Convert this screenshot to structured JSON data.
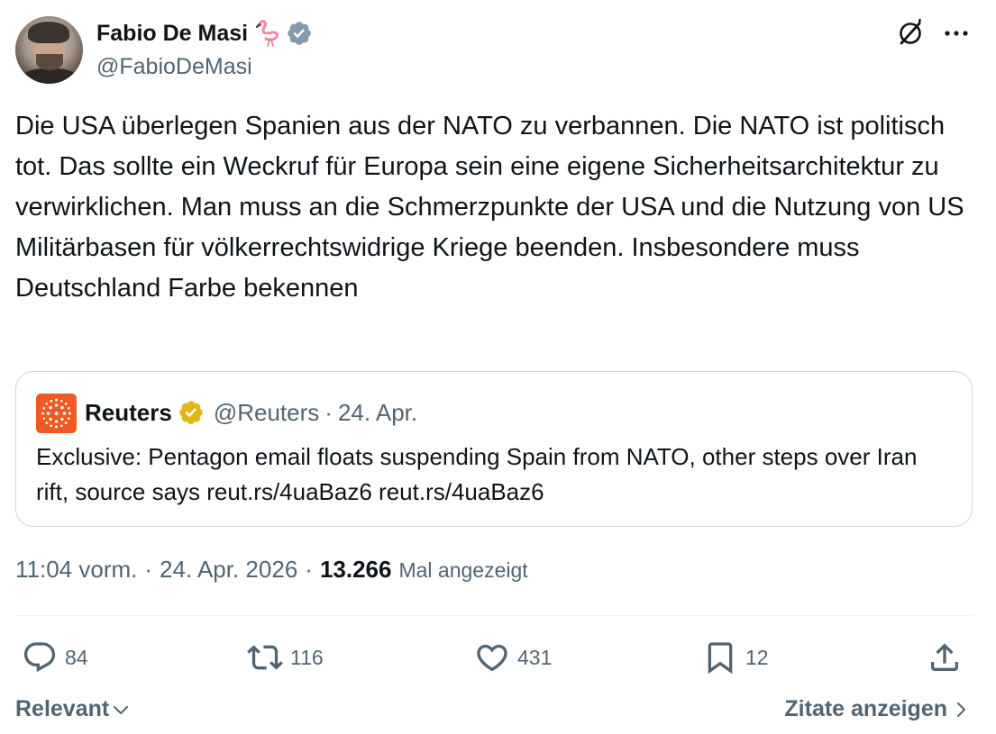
{
  "author": {
    "display_name": "Fabio De Masi",
    "handle": "@FabioDeMasi",
    "name_emoji": "flamingo-icon",
    "verified_badge_color": "#829aab"
  },
  "tweet": {
    "text": "Die USA überlegen Spanien aus der NATO zu verbannen. Die NATO ist politisch tot. Das sollte ein Weckruf für Europa sein eine eigene Sicherheitsarchitektur zu verwirklichen. Man muss an die Schmerzpunkte der USA und die Nutzung von US Militärbasen für völkerrechtswidrige Kriege beenden. Insbesondere muss Deutschland Farbe bekennen",
    "time": "11:04 vorm.",
    "date": "24. Apr. 2026",
    "views_count": "13.266",
    "views_label": "Mal angezeigt"
  },
  "quoted": {
    "name": "Reuters",
    "handle": "@Reuters",
    "separator": "·",
    "date": "24. Apr.",
    "text": "Exclusive: Pentagon email floats suspending Spain from NATO, other steps over Iran rift, source says reut.rs/4uaBaz6 reut.rs/4uaBaz6",
    "logo_color": "#f05a22",
    "verified_badge_color": "#e2b719"
  },
  "actions": {
    "replies": "84",
    "retweets": "116",
    "likes": "431",
    "bookmarks": "12"
  },
  "footer": {
    "sort_label": "Relevant",
    "quotes_label": "Zitate anzeigen"
  },
  "colors": {
    "text": "#0f1419",
    "secondary": "#536471",
    "border": "#cfd9de"
  }
}
